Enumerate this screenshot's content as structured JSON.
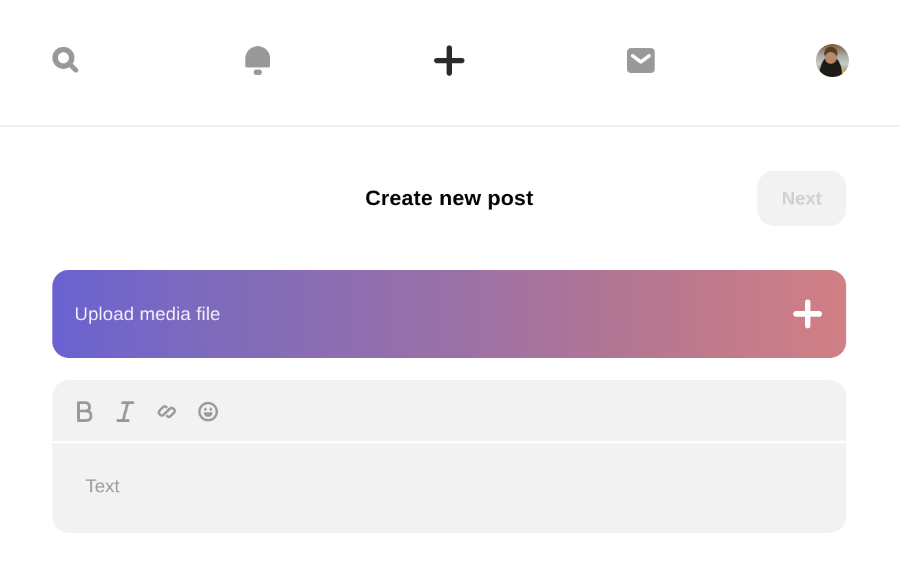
{
  "nav": {
    "items": [
      {
        "name": "search",
        "icon": "search-icon"
      },
      {
        "name": "notifications",
        "icon": "bell-icon"
      },
      {
        "name": "create",
        "icon": "plus-icon",
        "active": true
      },
      {
        "name": "messages",
        "icon": "mail-icon"
      },
      {
        "name": "profile",
        "icon": "avatar"
      }
    ]
  },
  "header": {
    "title": "Create new post",
    "next_label": "Next"
  },
  "upload": {
    "label": "Upload media file",
    "icon": "plus-icon"
  },
  "editor": {
    "tools": [
      {
        "name": "bold",
        "icon": "bold-icon"
      },
      {
        "name": "italic",
        "icon": "italic-icon"
      },
      {
        "name": "link",
        "icon": "link-icon"
      },
      {
        "name": "emoji",
        "icon": "emoji-icon"
      }
    ],
    "text_value": "",
    "text_placeholder": "Text"
  },
  "colors": {
    "icon_gray": "#999999",
    "icon_active": "#2b2b2b",
    "gradient_start": "#6a62d0",
    "gradient_end": "#d27f85",
    "surface": "#f2f2f2",
    "disabled_text": "#d0d0d0"
  }
}
